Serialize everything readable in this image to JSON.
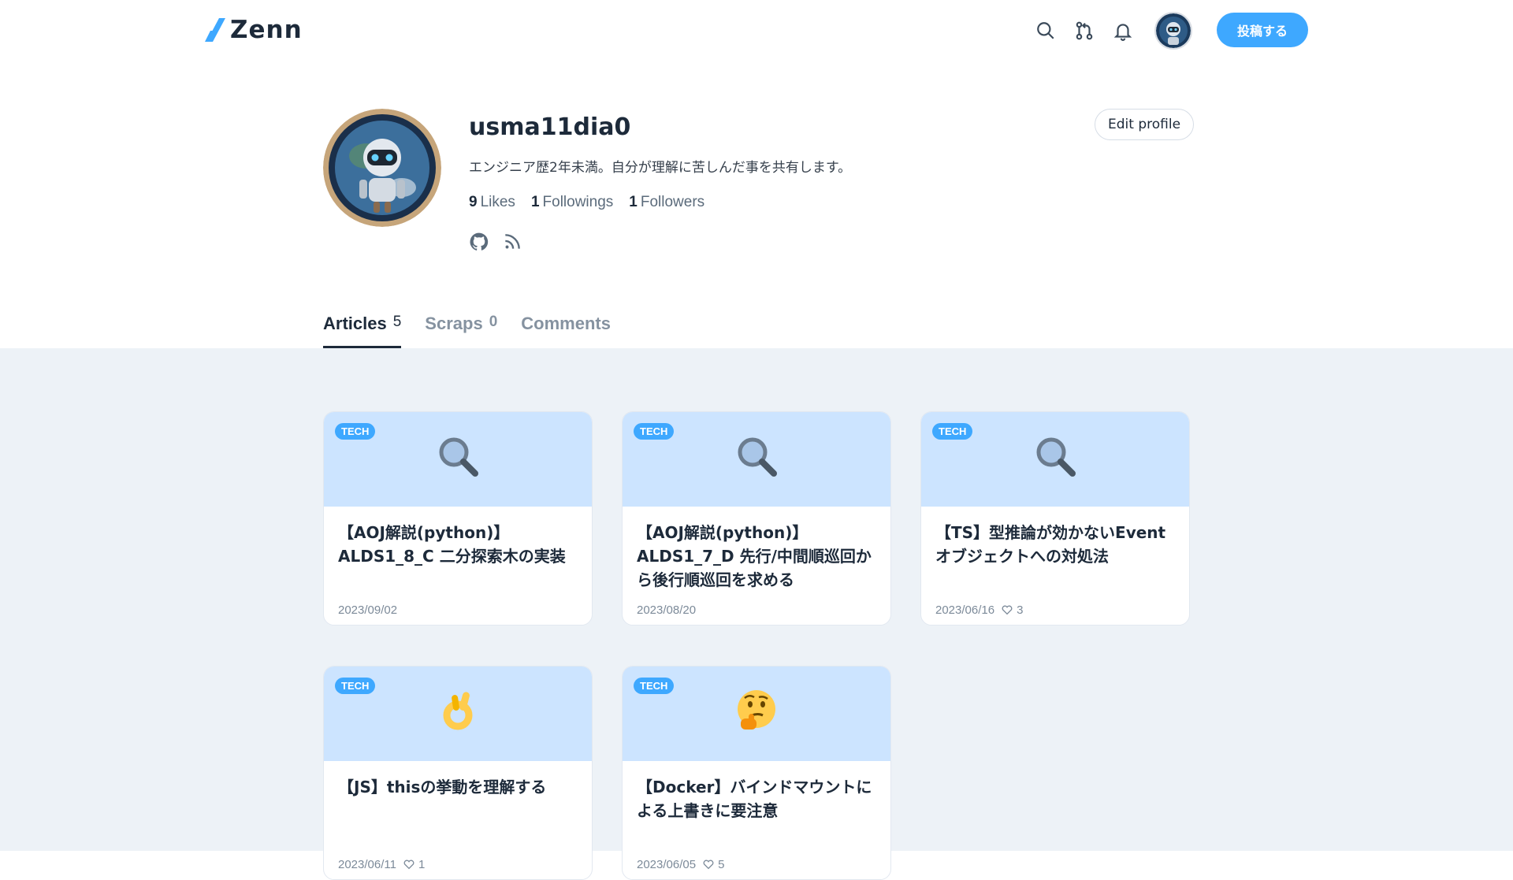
{
  "header": {
    "logo_text": "Zenn",
    "post_button": "投稿する",
    "icons": [
      "search-icon",
      "pull-request-icon",
      "bell-icon",
      "avatar"
    ]
  },
  "profile": {
    "username": "usma11dia0",
    "bio": "エンジニア歴2年未満。自分が理解に苦しんだ事を共有します。",
    "stats": [
      {
        "count": "9",
        "label": "Likes"
      },
      {
        "count": "1",
        "label": "Followings"
      },
      {
        "count": "1",
        "label": "Followers"
      }
    ],
    "edit_profile": "Edit profile",
    "social_icons": [
      "github-icon",
      "rss-icon"
    ]
  },
  "tabs": [
    {
      "label": "Articles",
      "count": "5",
      "active": true
    },
    {
      "label": "Scraps",
      "count": "0",
      "active": false
    },
    {
      "label": "Comments",
      "count": "",
      "active": false
    }
  ],
  "articles": [
    {
      "tag": "TECH",
      "emoji": "🔍",
      "title": "【AOJ解説(python)】ALDS1_8_C 二分探索木の実装",
      "date": "2023/09/02",
      "likes": ""
    },
    {
      "tag": "TECH",
      "emoji": "🔍",
      "title": "【AOJ解説(python)】ALDS1_7_D 先行/中間順巡回から後行順巡回を求める",
      "date": "2023/08/20",
      "likes": ""
    },
    {
      "tag": "TECH",
      "emoji": "🔍",
      "title": "【TS】型推論が効かないEventオブジェクトへの対処法",
      "date": "2023/06/16",
      "likes": "3"
    },
    {
      "tag": "TECH",
      "emoji": "👌",
      "title": "【JS】thisの挙動を理解する",
      "date": "2023/06/11",
      "likes": "1"
    },
    {
      "tag": "TECH",
      "emoji": "🤔",
      "title": "【Docker】バインドマウントによる上書きに要注意",
      "date": "2023/06/05",
      "likes": "5"
    }
  ],
  "colors": {
    "accent": "#3ea8ff",
    "card_header": "#cce4ff",
    "background": "#edf2f7"
  }
}
